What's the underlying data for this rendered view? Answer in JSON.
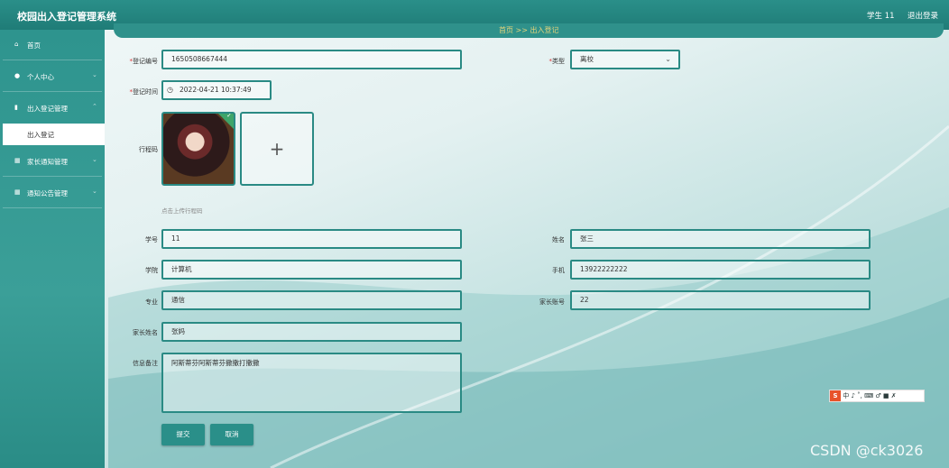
{
  "header": {
    "title": "校园出入登记管理系统",
    "user": "学生 11",
    "logout": "退出登录"
  },
  "sidebar": {
    "items": [
      {
        "label": "首页",
        "icon": "home-icon"
      },
      {
        "label": "个人中心",
        "icon": "user-icon"
      },
      {
        "label": "出入登记管理",
        "icon": "chart-icon"
      },
      {
        "label": "家长通知管理",
        "icon": "grid-icon"
      },
      {
        "label": "通知公告管理",
        "icon": "grid-icon"
      }
    ],
    "active_sub": "出入登记"
  },
  "breadcrumb": "首页 >> 出入登记",
  "form": {
    "reg_no": {
      "label": "登记编号",
      "value": "1650508667444"
    },
    "type": {
      "label": "类型",
      "value": "离校"
    },
    "reg_time": {
      "label": "登记时间",
      "value": "2022-04-21 10:37:49"
    },
    "trip_code": {
      "label": "行程码",
      "hint": "点击上传行程码"
    },
    "student_no": {
      "label": "学号",
      "value": "11"
    },
    "name": {
      "label": "姓名",
      "value": "张三"
    },
    "college": {
      "label": "学院",
      "value": "计算机"
    },
    "phone": {
      "label": "手机",
      "value": "13922222222"
    },
    "major": {
      "label": "专业",
      "value": "通信"
    },
    "parent_account": {
      "label": "家长账号",
      "value": "22"
    },
    "parent_name": {
      "label": "家长姓名",
      "value": "张妈"
    },
    "note": {
      "label": "信息备注",
      "value": "阿斯蒂芬阿斯蒂芬撒撒打撒撒"
    }
  },
  "buttons": {
    "submit": "提交",
    "cancel": "取消"
  },
  "ime": "中 ♪ ˚, ⌨ ♂ ■ ✗",
  "watermark": "CSDN @ck3026",
  "colors": {
    "primary": "#2a8f89",
    "breadcrumb": "#e4d37b"
  }
}
